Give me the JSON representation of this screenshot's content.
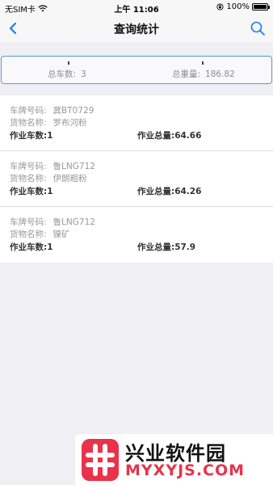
{
  "status_bar": {
    "carrier": "无SIM卡",
    "time": "上午 11:06",
    "battery": "100%",
    "battery_level": 1.0
  },
  "nav": {
    "title": "查询统计",
    "back_icon": "chevron-left-icon",
    "search_icon": "search-icon"
  },
  "summary": {
    "total_vehicles_label": "总车数:",
    "total_vehicles_value": "3",
    "total_weight_label": "总重量:",
    "total_weight_value": "186.82"
  },
  "records": [
    {
      "plate_label": "车牌号码:",
      "plate": "冀BT0729",
      "cargo_label": "货物名称:",
      "cargo": "罗布河粉",
      "trips": "作业车数:1",
      "weight": "作业总量:64.66"
    },
    {
      "plate_label": "车牌号码:",
      "plate": "鲁LNG712",
      "cargo_label": "货物名称:",
      "cargo": "伊朗粗粉",
      "trips": "作业车数:1",
      "weight": "作业总量:64.26"
    },
    {
      "plate_label": "车牌号码:",
      "plate": "鲁LNG712",
      "cargo_label": "货物名称:",
      "cargo": "镍矿",
      "trips": "作业车数:1",
      "weight": "作业总量:57.9"
    }
  ],
  "watermark": {
    "title": "兴业软件园",
    "url": "MYXYJS.COM"
  },
  "colors": {
    "accent": "#1a7cf2",
    "summary_border": "#5b9bd5",
    "watermark_red": "#e8334a"
  }
}
